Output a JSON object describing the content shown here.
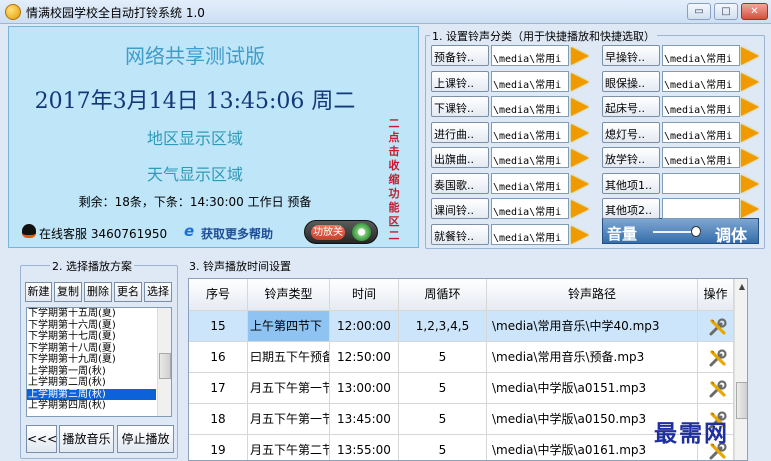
{
  "window": {
    "title": "情满校园学校全自动打铃系统 1.0",
    "min_icon": "minimize-icon",
    "max_icon": "maximize-icon",
    "close_icon": "close-icon",
    "min_glyph": "▭",
    "max_glyph": "□",
    "close_glyph": "✕"
  },
  "info_panel": {
    "network_title": "网络共享测试版",
    "clock": "2017年3月14日  13:45:06  周二",
    "region": "地区显示区域",
    "weather": "天气显示区域",
    "status": "剩余：18条，下条：14:30:00 工作日 预备",
    "collapse_label": "二点击收缩功能区二",
    "online_service": "在线客服 3460761950",
    "more_help": "获取更多帮助",
    "ie_glyph": "e",
    "power_label": "功放关"
  },
  "bell_categories": {
    "title": "1. 设置铃声分类（用于快捷播放和快捷选取）",
    "left": [
      {
        "label": "预备铃..",
        "path": "\\media\\常用i"
      },
      {
        "label": "上课铃..",
        "path": "\\media\\常用i"
      },
      {
        "label": "下课铃..",
        "path": "\\media\\常用i"
      },
      {
        "label": "进行曲..",
        "path": "\\media\\常用i"
      },
      {
        "label": "出旗曲..",
        "path": "\\media\\常用i"
      },
      {
        "label": "奏国歌..",
        "path": "\\media\\常用i"
      },
      {
        "label": "课间铃..",
        "path": "\\media\\常用i"
      },
      {
        "label": "就餐铃..",
        "path": "\\media\\常用i"
      }
    ],
    "right": [
      {
        "label": "早操铃..",
        "path": "\\media\\常用i"
      },
      {
        "label": "眼保操..",
        "path": "\\media\\常用i"
      },
      {
        "label": "起床号..",
        "path": "\\media\\常用i"
      },
      {
        "label": "熄灯号..",
        "path": "\\media\\常用i"
      },
      {
        "label": "放学铃..",
        "path": "\\media\\常用i"
      },
      {
        "label": "其他项1..",
        "path": ""
      },
      {
        "label": "其他项2..",
        "path": ""
      }
    ],
    "volume_label": "音量",
    "volume_level": 0.9,
    "adjust_label": "调体"
  },
  "scheme": {
    "title": "2. 选择播放方案",
    "buttons": [
      "新建",
      "复制",
      "删除",
      "更名",
      "选择"
    ],
    "items": [
      "下学期第十五周(夏)",
      "下学期第十六周(夏)",
      "下学期第十七周(夏)",
      "下学期第十八周(夏)",
      "下学期第十九周(夏)",
      "上学期第一周(秋)",
      "上学期第二周(秋)",
      "上学期第三周(秋)",
      "上学期第四周(秋)"
    ],
    "selected_index": 7,
    "back_label": "<<<",
    "play_label": "播放音乐",
    "stop_label": "停止播放"
  },
  "schedule": {
    "title": "3. 铃声播放时间设置",
    "columns": [
      "序号",
      "铃声类型",
      "时间",
      "周循环",
      "铃声路径",
      "操作"
    ],
    "rows": [
      {
        "no": "15",
        "type": "上午第四节下",
        "time": "12:00:00",
        "cycle": "1,2,3,4,5",
        "path": "\\media\\常用音乐\\中学40.mp3"
      },
      {
        "no": "16",
        "type": "曰期五下午预备",
        "time": "12:50:00",
        "cycle": "5",
        "path": "\\media\\常用音乐\\预备.mp3"
      },
      {
        "no": "17",
        "type": "月五下午第一节",
        "time": "13:00:00",
        "cycle": "5",
        "path": "\\media\\中学版\\a0151.mp3"
      },
      {
        "no": "18",
        "type": "月五下午第一节",
        "time": "13:45:00",
        "cycle": "5",
        "path": "\\media\\中学版\\a0150.mp3"
      },
      {
        "no": "19",
        "type": "月五下午第二节",
        "time": "13:55:00",
        "cycle": "5",
        "path": "\\media\\中学版\\a0161.mp3"
      }
    ],
    "highlight_index": 0,
    "scroll_up_glyph": "▲"
  },
  "watermark": "最需网"
}
